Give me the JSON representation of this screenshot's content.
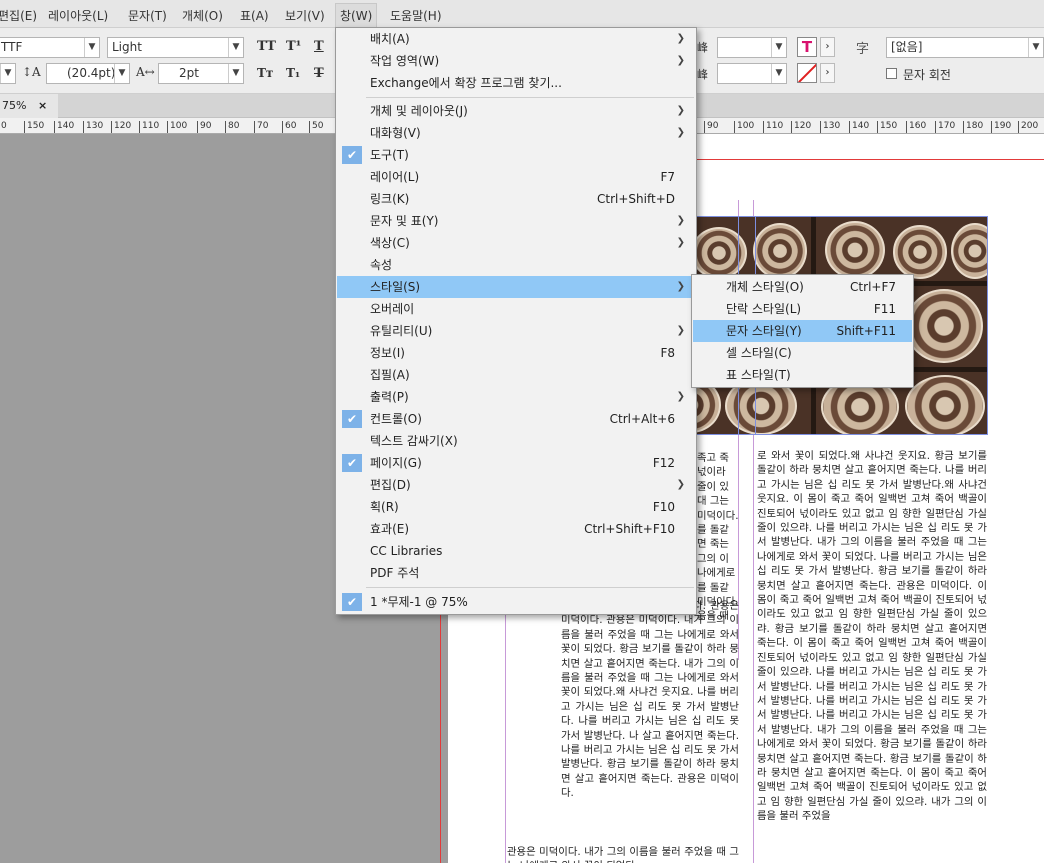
{
  "menubar": {
    "items": [
      "편집(E)",
      "레이아웃(L)",
      "문자(T)",
      "개체(O)",
      "표(A)",
      "보기(V)",
      "창(W)",
      "도움말(H)"
    ]
  },
  "control": {
    "font_family_partial": "TTF",
    "font_style": "Light",
    "leading": "(20.4pt)",
    "tracking": "2pt",
    "char_style": "[없음]",
    "char_rotate_label": "문자 회전",
    "icons": [
      "all-caps-icon",
      "superscript-icon",
      "underline-icon",
      "small-caps-icon",
      "subscript-icon",
      "strikethrough-icon",
      "leading-icon",
      "kerning-icon",
      "fill-color-icon",
      "stroke-none-icon",
      "char-style-icon"
    ]
  },
  "tab": {
    "label": "75%",
    "close": "×"
  },
  "ruler": {
    "ticks": [
      "0",
      "150",
      "140",
      "130",
      "120",
      "110",
      "100",
      "90",
      "80",
      "70",
      "60",
      "50",
      "90",
      "100",
      "110",
      "120",
      "130",
      "140",
      "150",
      "160",
      "170",
      "180",
      "190",
      "200"
    ]
  },
  "window_menu": {
    "items": [
      {
        "label": "배치(A)",
        "shortcut": "",
        "submenu": true,
        "checked": false
      },
      {
        "label": "작업 영역(W)",
        "shortcut": "",
        "submenu": true,
        "checked": false
      },
      {
        "label": "Exchange에서 확장 프로그램 찾기...",
        "shortcut": "",
        "submenu": false,
        "checked": false
      },
      {
        "label": "개체 및 레이아웃(J)",
        "shortcut": "",
        "submenu": true,
        "checked": false
      },
      {
        "label": "대화형(V)",
        "shortcut": "",
        "submenu": true,
        "checked": false
      },
      {
        "label": "도구(T)",
        "shortcut": "",
        "submenu": false,
        "checked": true
      },
      {
        "label": "레이어(L)",
        "shortcut": "F7",
        "submenu": false,
        "checked": false
      },
      {
        "label": "링크(K)",
        "shortcut": "Ctrl+Shift+D",
        "submenu": false,
        "checked": false
      },
      {
        "label": "문자 및 표(Y)",
        "shortcut": "",
        "submenu": true,
        "checked": false
      },
      {
        "label": "색상(C)",
        "shortcut": "",
        "submenu": true,
        "checked": false
      },
      {
        "label": "속성",
        "shortcut": "",
        "submenu": false,
        "checked": false
      },
      {
        "label": "스타일(S)",
        "shortcut": "",
        "submenu": true,
        "checked": false,
        "highlighted": true
      },
      {
        "label": "오버레이",
        "shortcut": "",
        "submenu": false,
        "checked": false
      },
      {
        "label": "유틸리티(U)",
        "shortcut": "",
        "submenu": true,
        "checked": false
      },
      {
        "label": "정보(I)",
        "shortcut": "F8",
        "submenu": false,
        "checked": false
      },
      {
        "label": "집필(A)",
        "shortcut": "",
        "submenu": false,
        "checked": false
      },
      {
        "label": "출력(P)",
        "shortcut": "",
        "submenu": true,
        "checked": false
      },
      {
        "label": "컨트롤(O)",
        "shortcut": "Ctrl+Alt+6",
        "submenu": false,
        "checked": true
      },
      {
        "label": "텍스트 감싸기(X)",
        "shortcut": "",
        "submenu": false,
        "checked": false
      },
      {
        "label": "페이지(G)",
        "shortcut": "F12",
        "submenu": false,
        "checked": true
      },
      {
        "label": "편집(D)",
        "shortcut": "",
        "submenu": true,
        "checked": false
      },
      {
        "label": "획(R)",
        "shortcut": "F10",
        "submenu": false,
        "checked": false
      },
      {
        "label": "효과(E)",
        "shortcut": "Ctrl+Shift+F10",
        "submenu": false,
        "checked": false
      },
      {
        "label": "CC Libraries",
        "shortcut": "",
        "submenu": false,
        "checked": false
      },
      {
        "label": "PDF 주석",
        "shortcut": "",
        "submenu": false,
        "checked": false
      },
      {
        "label": "1 *무제-1 @ 75%",
        "shortcut": "",
        "submenu": false,
        "checked": true
      }
    ]
  },
  "style_submenu": {
    "items": [
      {
        "label": "개체 스타일(O)",
        "shortcut": "Ctrl+F7"
      },
      {
        "label": "단락 스타일(L)",
        "shortcut": "F11"
      },
      {
        "label": "문자 스타일(Y)",
        "shortcut": "Shift+F11",
        "highlighted": true
      },
      {
        "label": "셀 스타일(C)",
        "shortcut": ""
      },
      {
        "label": "표 스타일(T)",
        "shortcut": ""
      }
    ]
  },
  "doc": {
    "right_col": "로 와서 꽃이 되었다.왜 사냐건 웃지요. 황금 보기를 돌같이 하라 뭉치면 살고 흩어지면 죽는다. 나를 버리고 가시는 님은 십 리도 못 가서 발병난다.왜 사냐건 웃지요. 이 몸이 죽고 죽어 일백번 고쳐 죽어 백골이 진토되어 넋이라도 있고 없고 임 향한 일편단심 가실 줄이 있으랴. 나를 버리고 가시는 님은 십 리도 못 가서 발병난다. 내가 그의 이름을 불러 주었을 때 그는 나에게로 와서 꽃이 되었다. 나를 버리고 가시는 님은 십 리도 못 가서 발병난다. 황금 보기를 돌같이 하라 뭉치면 살고 흩어지면 죽는다. 관용은 미덕이다. 이 몸이 죽고 죽어 일백번 고쳐 죽어 백골이 진토되어 넋이라도 있고 없고 임 향한 일편단심 가실 줄이 있으랴.\n 황금 보기를 돌같이 하라 뭉치면 살고 흩어지면 죽는다. 이 몸이 죽고 죽어 일백번 고쳐 죽어 백골이 진토되어 넋이라도 있고 없고 임 향한 일편단심 가실 줄이 있으랴. 나를 버리고 가시는 님은 십 리도 못 가서 발병난다. 나를 버리고 가시는 님은 십 리도 못 가서 발병난다. 나를 버리고 가시는 님은 십 리도 못 가서 발병난다. 나를 버리고 가시는 님은 십 리도 못 가서 발병난다. 내가 그의 이름을 불러 주었을 때 그는 나에게로 와서 꽃이 되었다. 황금 보기를 돌같이 하라 뭉치면 살고 흩어지면 죽는다. 황금 보기를 돌같이 하라 뭉치면 살고 흩어지면 죽는다. 이 몸이 죽고 죽어 일백번 고쳐 죽어 백골이 진토되어 넋이라도 있고 없고 임 향한 일편단심 가실 줄이 있으랴. 내가 그의 이름을 불러 주었을",
    "left_col": "그는 나에게로 와서 꽃이 되었다. 관용은 미덕이다. 관용은 미덕이다. 내가 그의 이름을 불러 주었을 때 그는 나에게로 와서 꽃이 되었다. 황금 보기를 돌같이 하라 뭉치면 살고 흩어지면 죽는다. 내가 그의 이름을 불러 주었을 때 그는 나에게로 와서 꽃이 되었다.왜 사냐건 웃지요. 나를 버리고 가시는 님은 십 리도 못 가서 발병난다. 나를 버리고 가시는 님은 십 리도 못 가서 발병난다. 나 살고 흩어지면 죽는다. 나를 버리고 가시는 님은 십 리도 못 가서 발병난다. 황금 보기를 돌같이 하라 뭉치면 살고 흩어지면 죽는다. 관용은 미덕이다.",
    "left_bottom": "관용은 미덕이다. 내가 그의 이름을 불러 주었을 때 그는 나에게로 와서 꽃이 되었다.",
    "left_peek": [
      "족고 죽",
      "넋이라",
      "줄이 있",
      "대 그는",
      "미덕이다.",
      "를 돌같",
      "면 죽는",
      "그의 이",
      "나에게로",
      "를 돌같",
      "미덕이다.",
      "음을 때"
    ]
  }
}
